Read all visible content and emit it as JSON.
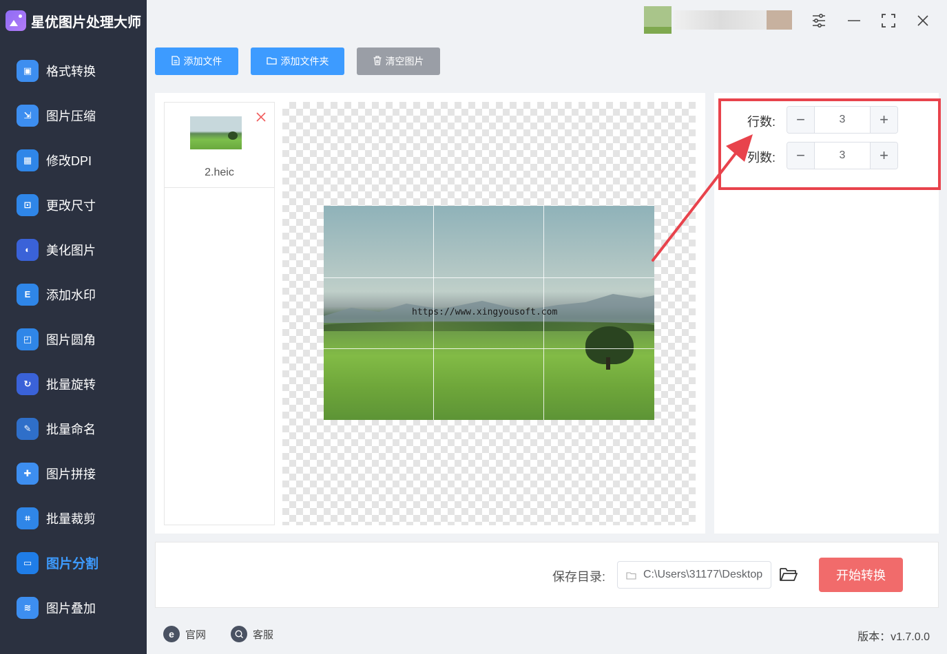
{
  "app": {
    "title": "星优图片处理大师"
  },
  "sidebar": {
    "items": [
      {
        "label": "格式转换",
        "icon": "image-convert-icon",
        "color": "#3d8ef0"
      },
      {
        "label": "图片压缩",
        "icon": "compress-icon",
        "color": "#3d8ef0"
      },
      {
        "label": "修改DPI",
        "icon": "dpi-icon",
        "color": "#2f86e8"
      },
      {
        "label": "更改尺寸",
        "icon": "resize-icon",
        "color": "#2f86e8"
      },
      {
        "label": "美化图片",
        "icon": "beautify-icon",
        "color": "#3a62d8"
      },
      {
        "label": "添加水印",
        "icon": "watermark-icon",
        "color": "#2f86e8"
      },
      {
        "label": "图片圆角",
        "icon": "round-corner-icon",
        "color": "#2f86e8"
      },
      {
        "label": "批量旋转",
        "icon": "rotate-icon",
        "color": "#3a62d8"
      },
      {
        "label": "批量命名",
        "icon": "rename-icon",
        "color": "#2f6fc9"
      },
      {
        "label": "图片拼接",
        "icon": "puzzle-icon",
        "color": "#3d8ef0"
      },
      {
        "label": "批量裁剪",
        "icon": "crop-icon",
        "color": "#2f86e8"
      },
      {
        "label": "图片分割",
        "icon": "split-icon",
        "color": "#1f7de8"
      },
      {
        "label": "图片叠加",
        "icon": "layers-icon",
        "color": "#3d8ef0"
      }
    ],
    "active_index": 11
  },
  "toolbar": {
    "add_file": "添加文件",
    "add_folder": "添加文件夹",
    "clear": "清空图片"
  },
  "files": [
    {
      "name": "2.heic"
    }
  ],
  "preview": {
    "watermark": "https://www.xingyousoft.com"
  },
  "settings": {
    "rows_label": "行数:",
    "rows_value": "3",
    "cols_label": "列数:",
    "cols_value": "3"
  },
  "output": {
    "save_label": "保存目录:",
    "path": "C:\\Users\\31177\\Desktop",
    "start_label": "开始转换"
  },
  "footer": {
    "site": "官网",
    "support": "客服",
    "version": "版本：v1.7.0.0"
  },
  "colors": {
    "accent": "#3d9bff",
    "sidebar_bg": "#2b3140",
    "start_button": "#f16b6b",
    "highlight": "#e8434c"
  }
}
